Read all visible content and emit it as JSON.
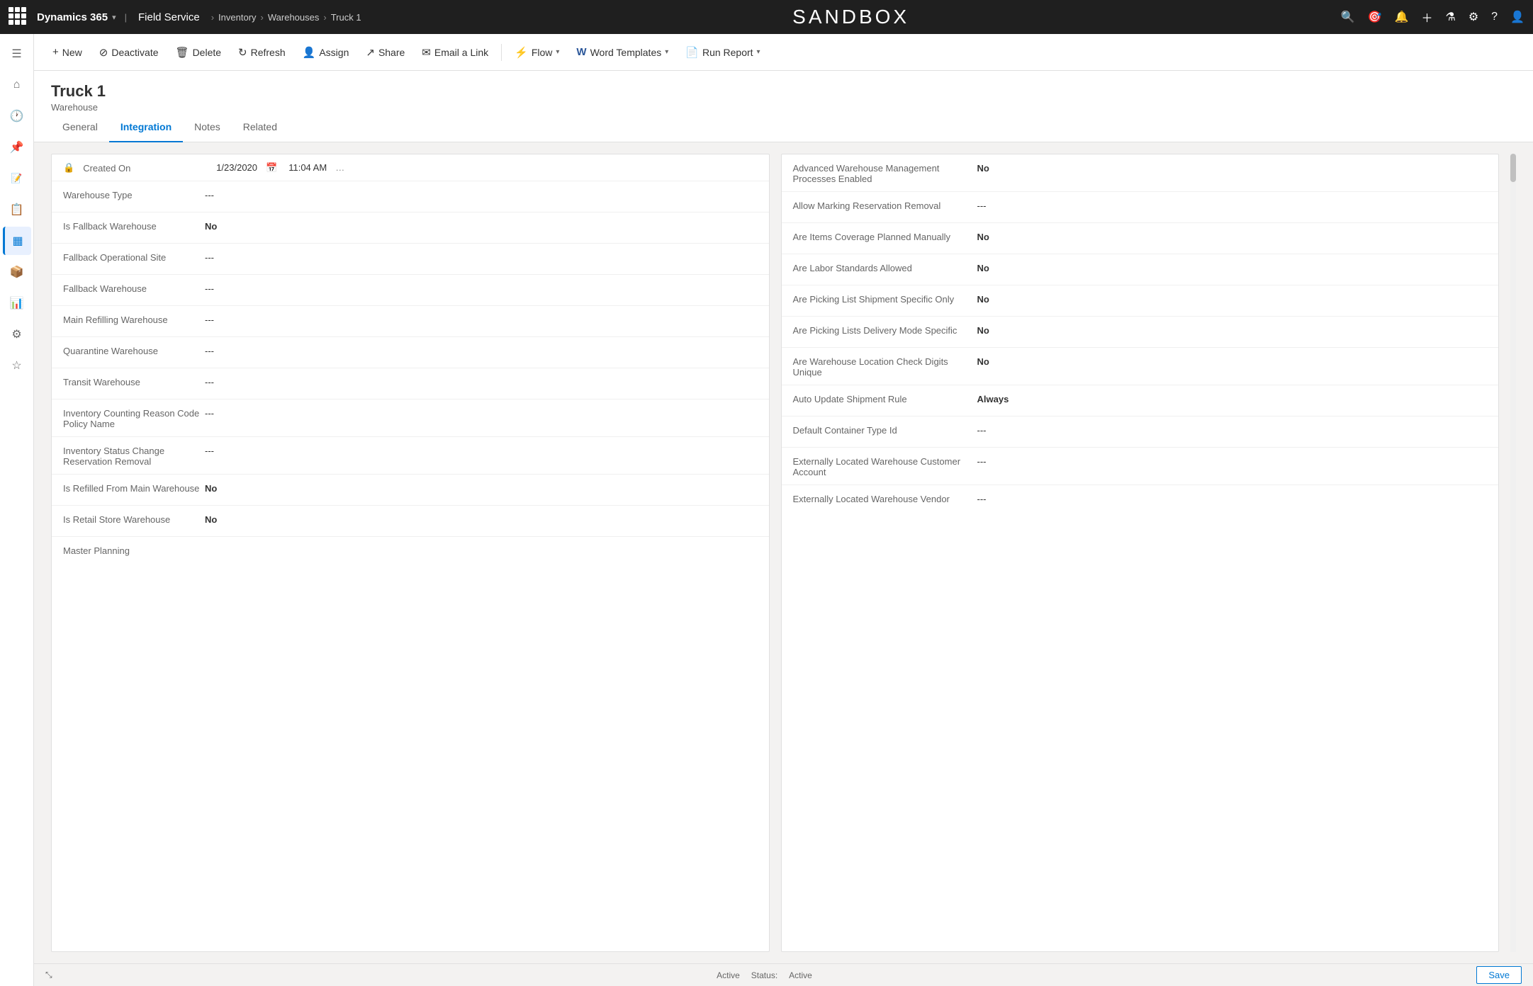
{
  "topNav": {
    "waffle": "waffle-icon",
    "brandName": "Dynamics 365",
    "appName": "Field Service",
    "breadcrumbs": [
      "Inventory",
      "Warehouses",
      "Truck 1"
    ],
    "sandboxTitle": "SANDBOX",
    "icons": [
      "search-icon",
      "target-icon",
      "bell-icon",
      "plus-icon",
      "filter-icon",
      "settings-icon",
      "help-icon",
      "user-icon"
    ]
  },
  "commandBar": {
    "buttons": [
      {
        "id": "new",
        "icon": "+",
        "label": "New",
        "hasChevron": false
      },
      {
        "id": "deactivate",
        "icon": "⊘",
        "label": "Deactivate",
        "hasChevron": false
      },
      {
        "id": "delete",
        "icon": "🗑",
        "label": "Delete",
        "hasChevron": false
      },
      {
        "id": "refresh",
        "icon": "↻",
        "label": "Refresh",
        "hasChevron": false
      },
      {
        "id": "assign",
        "icon": "👤",
        "label": "Assign",
        "hasChevron": false
      },
      {
        "id": "share",
        "icon": "↗",
        "label": "Share",
        "hasChevron": false
      },
      {
        "id": "email-link",
        "icon": "✉",
        "label": "Email a Link",
        "hasChevron": false
      },
      {
        "id": "flow",
        "icon": "⚡",
        "label": "Flow",
        "hasChevron": true
      },
      {
        "id": "word-templates",
        "icon": "W",
        "label": "Word Templates",
        "hasChevron": true
      },
      {
        "id": "run-report",
        "icon": "📄",
        "label": "Run Report",
        "hasChevron": true
      }
    ]
  },
  "page": {
    "title": "Truck 1",
    "subtitle": "Warehouse"
  },
  "tabs": [
    {
      "id": "general",
      "label": "General",
      "active": false
    },
    {
      "id": "integration",
      "label": "Integration",
      "active": true
    },
    {
      "id": "notes",
      "label": "Notes",
      "active": false
    },
    {
      "id": "related",
      "label": "Related",
      "active": false
    }
  ],
  "leftColumn": {
    "createdOn": {
      "label": "Created On",
      "date": "1/23/2020",
      "time": "11:04 AM"
    },
    "fields": [
      {
        "label": "Warehouse Type",
        "value": "---",
        "bold": false
      },
      {
        "label": "Is Fallback Warehouse",
        "value": "No",
        "bold": true
      },
      {
        "label": "Fallback Operational Site",
        "value": "---",
        "bold": false
      },
      {
        "label": "Fallback Warehouse",
        "value": "---",
        "bold": false
      },
      {
        "label": "Main Refilling Warehouse",
        "value": "---",
        "bold": false
      },
      {
        "label": "Quarantine Warehouse",
        "value": "---",
        "bold": false
      },
      {
        "label": "Transit Warehouse",
        "value": "---",
        "bold": false
      },
      {
        "label": "Inventory Counting Reason Code Policy Name",
        "value": "---",
        "bold": false
      },
      {
        "label": "Inventory Status Change Reservation Removal",
        "value": "---",
        "bold": false
      },
      {
        "label": "Is Refilled From Main Warehouse",
        "value": "No",
        "bold": true
      },
      {
        "label": "Is Retail Store Warehouse",
        "value": "No",
        "bold": true
      },
      {
        "label": "Master Planning",
        "value": "",
        "bold": false
      }
    ]
  },
  "rightColumn": {
    "fields": [
      {
        "label": "Advanced Warehouse Management Processes Enabled",
        "value": "No",
        "bold": true
      },
      {
        "label": "Allow Marking Reservation Removal",
        "value": "---",
        "bold": false
      },
      {
        "label": "Are Items Coverage Planned Manually",
        "value": "No",
        "bold": true
      },
      {
        "label": "Are Labor Standards Allowed",
        "value": "No",
        "bold": true
      },
      {
        "label": "Are Picking List Shipment Specific Only",
        "value": "No",
        "bold": true
      },
      {
        "label": "Are Picking Lists Delivery Mode Specific",
        "value": "No",
        "bold": true
      },
      {
        "label": "Are Warehouse Location Check Digits Unique",
        "value": "No",
        "bold": true
      },
      {
        "label": "Auto Update Shipment Rule",
        "value": "Always",
        "bold": true
      },
      {
        "label": "Default Container Type Id",
        "value": "---",
        "bold": false
      },
      {
        "label": "Externally Located Warehouse Customer Account",
        "value": "---",
        "bold": false
      },
      {
        "label": "Externally Located Warehouse Vendor",
        "value": "---",
        "bold": false
      }
    ]
  },
  "statusBar": {
    "expandIcon": "⤡",
    "status1Label": "Active",
    "statusLabel": "Status:",
    "status2Label": "Active",
    "saveLabel": "Save"
  },
  "sidebar": {
    "items": [
      {
        "id": "home",
        "icon": "⌂",
        "label": "Home"
      },
      {
        "id": "recent",
        "icon": "🕐",
        "label": "Recent"
      },
      {
        "id": "pinned",
        "icon": "📌",
        "label": "Pinned"
      },
      {
        "id": "notes2",
        "icon": "📝",
        "label": "Notes"
      },
      {
        "id": "list",
        "icon": "☰",
        "label": "List"
      },
      {
        "id": "active",
        "icon": "▦",
        "label": "Active",
        "active": true
      },
      {
        "id": "box",
        "icon": "📦",
        "label": "Box"
      },
      {
        "id": "reports",
        "icon": "📊",
        "label": "Reports"
      },
      {
        "id": "settings2",
        "icon": "⚙",
        "label": "Settings"
      },
      {
        "id": "star",
        "icon": "☆",
        "label": "Favorites"
      }
    ]
  }
}
